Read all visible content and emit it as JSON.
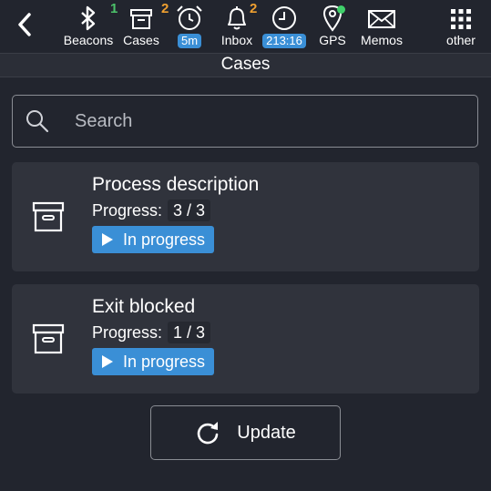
{
  "topbar": {
    "nav": [
      {
        "id": "beacons",
        "label": "Beacons",
        "icon": "bluetooth-icon",
        "badge": "1",
        "badge_color": "#4cc26a"
      },
      {
        "id": "cases",
        "label": "Cases",
        "icon": "archive-box-icon",
        "badge": "2",
        "badge_color": "#f0a030"
      },
      {
        "id": "alarm",
        "label": "5m",
        "icon": "alarm-clock-icon"
      },
      {
        "id": "inbox",
        "label": "Inbox",
        "icon": "bell-icon",
        "badge": "2",
        "badge_color": "#f0a030"
      },
      {
        "id": "clock",
        "label": "213:16",
        "icon": "clock-icon"
      },
      {
        "id": "gps",
        "label": "GPS",
        "icon": "location-pin-icon",
        "status_color": "#3fd06a"
      },
      {
        "id": "memos",
        "label": "Memos",
        "icon": "envelope-icon"
      },
      {
        "id": "other",
        "label": "other",
        "icon": "grid-menu-icon"
      }
    ]
  },
  "page_title": "Cases",
  "search": {
    "placeholder": "Search"
  },
  "cases": [
    {
      "title": "Process description",
      "progress_label": "Progress:",
      "progress_value": "3 / 3",
      "status": "In progress"
    },
    {
      "title": "Exit blocked",
      "progress_label": "Progress:",
      "progress_value": "1 / 3",
      "status": "In progress"
    }
  ],
  "update_button": "Update",
  "colors": {
    "background": "#22252e",
    "card": "#30333c",
    "accent": "#3a8fd6"
  }
}
